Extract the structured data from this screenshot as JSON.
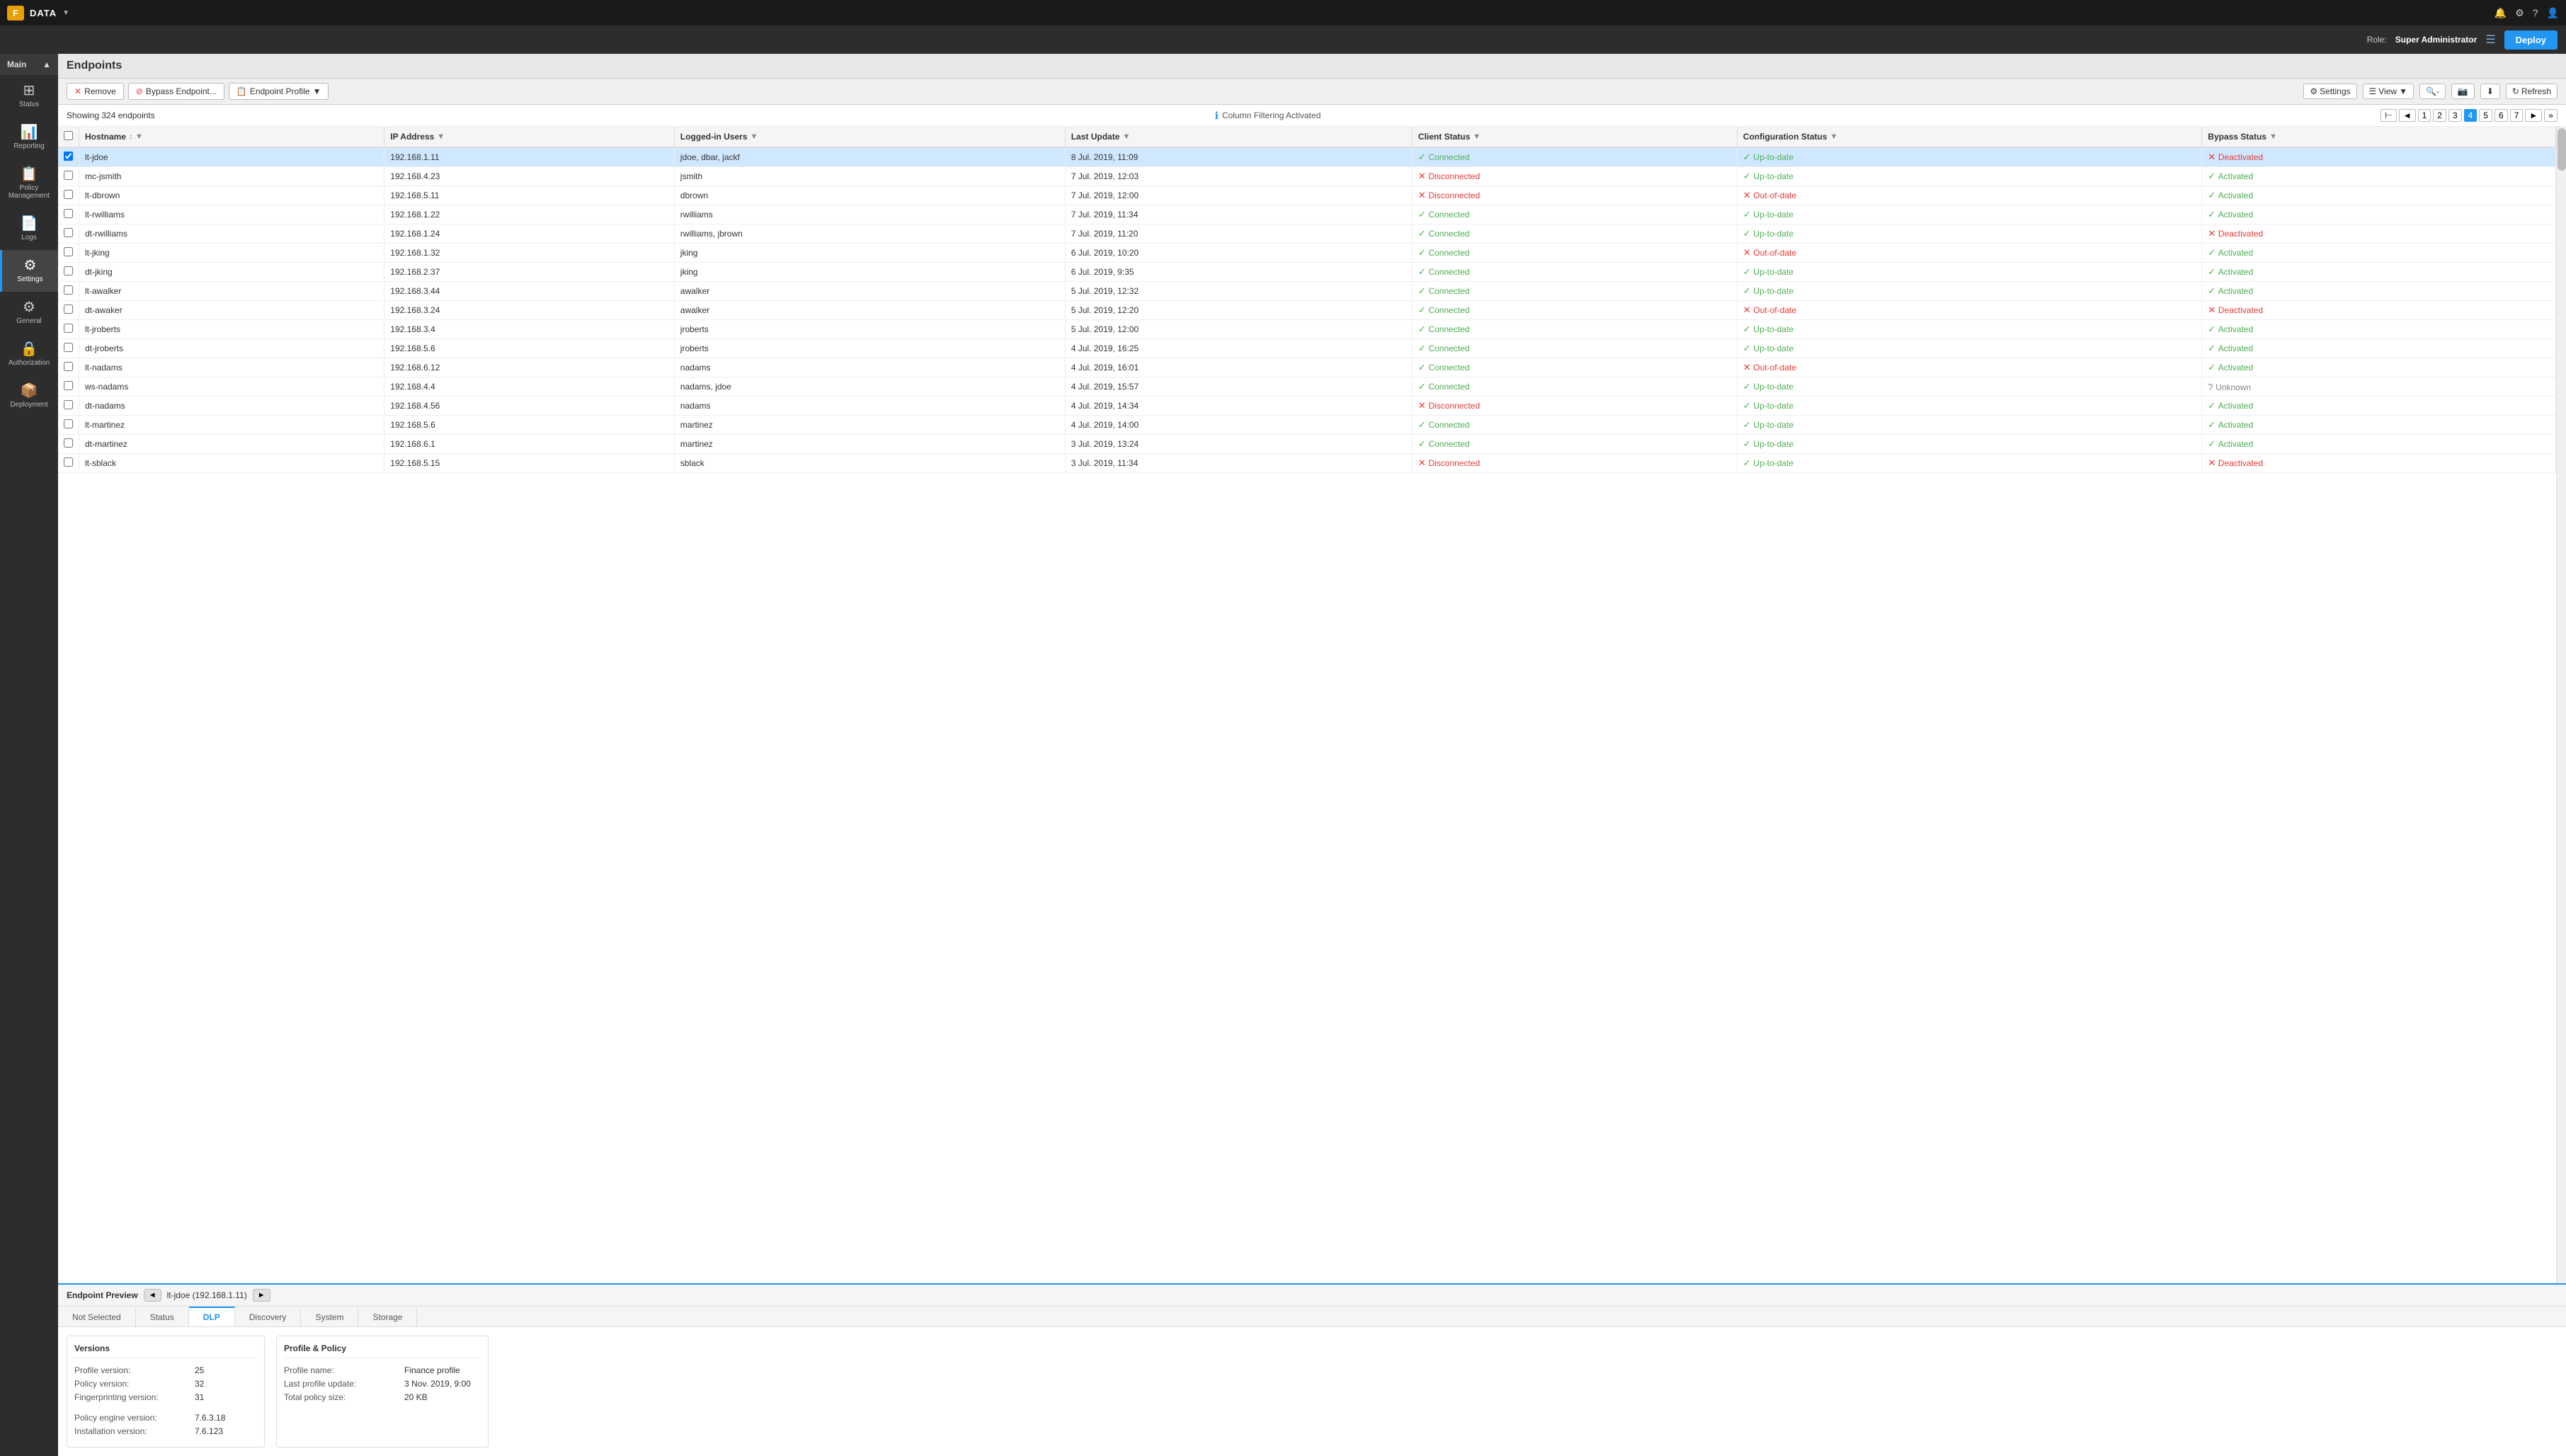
{
  "app": {
    "logo": "F",
    "title": "DATA",
    "role_label": "Role:",
    "role_name": "Super Administrator",
    "deploy_btn": "Deploy"
  },
  "sidebar": {
    "main_label": "Main",
    "items": [
      {
        "id": "status",
        "label": "Status",
        "icon": "⊞",
        "active": false
      },
      {
        "id": "reporting",
        "label": "Reporting",
        "icon": "📊",
        "active": false
      },
      {
        "id": "policy-management",
        "label": "Policy Management",
        "icon": "📋",
        "active": false
      },
      {
        "id": "logs",
        "label": "Logs",
        "icon": "📄",
        "active": false
      },
      {
        "id": "settings",
        "label": "Settings",
        "icon": "⚙",
        "active": true
      },
      {
        "id": "general",
        "label": "General",
        "icon": "⚙",
        "active": false
      },
      {
        "id": "authorization",
        "label": "Authorization",
        "icon": "🔒",
        "active": false
      },
      {
        "id": "deployment",
        "label": "Deployment",
        "icon": "📦",
        "active": false
      }
    ]
  },
  "page": {
    "title": "Endpoints",
    "endpoint_count": "Showing 324 endpoints",
    "filter_notice": "Column Filtering Activated"
  },
  "toolbar": {
    "remove_btn": "Remove",
    "bypass_btn": "Bypass Endpoint...",
    "profile_btn": "Endpoint Profile",
    "settings_btn": "Settings",
    "view_btn": "View",
    "refresh_btn": "Refresh"
  },
  "pagination": {
    "pages": [
      "1",
      "2",
      "3",
      "4",
      "5",
      "6",
      "7"
    ],
    "active_page": "4",
    "prev": "◄",
    "next": "►",
    "last": "»"
  },
  "table": {
    "columns": [
      "Hostname",
      "IP Address",
      "Logged-in Users",
      "Last Update",
      "Client Status",
      "Configuration Status",
      "Bypass Status"
    ],
    "rows": [
      {
        "hostname": "lt-jdoe",
        "ip": "192.168.1.11",
        "users": "jdoe, dbar, jackf",
        "last_update": "8 Jul. 2019, 11:09",
        "client_status": "Connected",
        "client_ok": true,
        "config_status": "Up-to-date",
        "config_ok": true,
        "bypass_status": "Deactivated",
        "bypass_ok": false,
        "selected": true
      },
      {
        "hostname": "mc-jsmith",
        "ip": "192.168.4.23",
        "users": "jsmith",
        "last_update": "7 Jul. 2019, 12:03",
        "client_status": "Disconnected",
        "client_ok": false,
        "config_status": "Up-to-date",
        "config_ok": true,
        "bypass_status": "Activated",
        "bypass_ok": true,
        "selected": false
      },
      {
        "hostname": "lt-dbrown",
        "ip": "192.168.5.11",
        "users": "dbrown",
        "last_update": "7 Jul. 2019, 12:00",
        "client_status": "Disconnected",
        "client_ok": false,
        "config_status": "Out-of-date",
        "config_ok": false,
        "bypass_status": "Activated",
        "bypass_ok": true,
        "selected": false
      },
      {
        "hostname": "lt-rwilliams",
        "ip": "192.168.1.22",
        "users": "rwilliams",
        "last_update": "7 Jul. 2019, 11:34",
        "client_status": "Connected",
        "client_ok": true,
        "config_status": "Up-to-date",
        "config_ok": true,
        "bypass_status": "Activated",
        "bypass_ok": true,
        "selected": false
      },
      {
        "hostname": "dt-rwilliams",
        "ip": "192.168.1.24",
        "users": "rwilliams, jbrown",
        "last_update": "7 Jul. 2019, 11:20",
        "client_status": "Connected",
        "client_ok": true,
        "config_status": "Up-to-date",
        "config_ok": true,
        "bypass_status": "Deactivated",
        "bypass_ok": false,
        "selected": false
      },
      {
        "hostname": "lt-jking",
        "ip": "192.168.1.32",
        "users": "jking",
        "last_update": "6 Jul. 2019, 10:20",
        "client_status": "Connected",
        "client_ok": true,
        "config_status": "Out-of-date",
        "config_ok": false,
        "bypass_status": "Activated",
        "bypass_ok": true,
        "selected": false
      },
      {
        "hostname": "dt-jking",
        "ip": "192.168.2.37",
        "users": "jking",
        "last_update": "6 Jul. 2019, 9:35",
        "client_status": "Connected",
        "client_ok": true,
        "config_status": "Up-to-date",
        "config_ok": true,
        "bypass_status": "Activated",
        "bypass_ok": true,
        "selected": false
      },
      {
        "hostname": "lt-awalker",
        "ip": "192.168.3.44",
        "users": "awalker",
        "last_update": "5 Jul. 2019, 12:32",
        "client_status": "Connected",
        "client_ok": true,
        "config_status": "Up-to-date",
        "config_ok": true,
        "bypass_status": "Activated",
        "bypass_ok": true,
        "selected": false
      },
      {
        "hostname": "dt-awaker",
        "ip": "192.168.3.24",
        "users": "awalker",
        "last_update": "5 Jul. 2019, 12:20",
        "client_status": "Connected",
        "client_ok": true,
        "config_status": "Out-of-date",
        "config_ok": false,
        "bypass_status": "Deactivated",
        "bypass_ok": false,
        "selected": false
      },
      {
        "hostname": "lt-jroberts",
        "ip": "192.168.3.4",
        "users": "jroberts",
        "last_update": "5 Jul. 2019, 12:00",
        "client_status": "Connected",
        "client_ok": true,
        "config_status": "Up-to-date",
        "config_ok": true,
        "bypass_status": "Activated",
        "bypass_ok": true,
        "selected": false
      },
      {
        "hostname": "dt-jroberts",
        "ip": "192.168.5.6",
        "users": "jroberts",
        "last_update": "4 Jul. 2019, 16:25",
        "client_status": "Connected",
        "client_ok": true,
        "config_status": "Up-to-date",
        "config_ok": true,
        "bypass_status": "Activated",
        "bypass_ok": true,
        "selected": false
      },
      {
        "hostname": "lt-nadams",
        "ip": "192.168.6.12",
        "users": "nadams",
        "last_update": "4 Jul. 2019, 16:01",
        "client_status": "Connected",
        "client_ok": true,
        "config_status": "Out-of-date",
        "config_ok": false,
        "bypass_status": "Activated",
        "bypass_ok": true,
        "selected": false
      },
      {
        "hostname": "ws-nadams",
        "ip": "192.168.4.4",
        "users": "nadams, jdoe",
        "last_update": "4 Jul. 2019, 15:57",
        "client_status": "Connected",
        "client_ok": true,
        "config_status": "Up-to-date",
        "config_ok": true,
        "bypass_status": "Unknown",
        "bypass_ok": null,
        "selected": false
      },
      {
        "hostname": "dt-nadams",
        "ip": "192.168.4.56",
        "users": "nadams",
        "last_update": "4 Jul. 2019, 14:34",
        "client_status": "Disconnected",
        "client_ok": false,
        "config_status": "Up-to-date",
        "config_ok": true,
        "bypass_status": "Activated",
        "bypass_ok": true,
        "selected": false
      },
      {
        "hostname": "lt-martinez",
        "ip": "192.168.5.6",
        "users": "martinez",
        "last_update": "4 Jul. 2019, 14:00",
        "client_status": "Connected",
        "client_ok": true,
        "config_status": "Up-to-date",
        "config_ok": true,
        "bypass_status": "Activated",
        "bypass_ok": true,
        "selected": false
      },
      {
        "hostname": "dt-martinez",
        "ip": "192.168.6.1",
        "users": "martinez",
        "last_update": "3 Jul. 2019, 13:24",
        "client_status": "Connected",
        "client_ok": true,
        "config_status": "Up-to-date",
        "config_ok": true,
        "bypass_status": "Activated",
        "bypass_ok": true,
        "selected": false
      },
      {
        "hostname": "lt-sblack",
        "ip": "192.168.5.15",
        "users": "sblack",
        "last_update": "3 Jul. 2019, 11:34",
        "client_status": "Disconnected",
        "client_ok": false,
        "config_status": "Up-to-date",
        "config_ok": true,
        "bypass_status": "Deactivated",
        "bypass_ok": false,
        "selected": false
      }
    ]
  },
  "endpoint_preview": {
    "title": "Endpoint Preview",
    "endpoint_name": "lt-jdoe (192.168.1.11)",
    "tabs": [
      {
        "id": "not-selected",
        "label": "Not Selected"
      },
      {
        "id": "status",
        "label": "Status"
      },
      {
        "id": "dlp",
        "label": "DLP",
        "active": true
      },
      {
        "id": "discovery",
        "label": "Discovery"
      },
      {
        "id": "system",
        "label": "System"
      },
      {
        "id": "storage",
        "label": "Storage"
      }
    ],
    "dlp": {
      "versions_title": "Versions",
      "profile_policy_title": "Profile & Policy",
      "profile_version_label": "Profile version:",
      "profile_version": "25",
      "policy_version_label": "Policy version:",
      "policy_version": "32",
      "fingerprinting_label": "Fingerprinting version:",
      "fingerprinting_version": "31",
      "policy_engine_label": "Policy engine version:",
      "policy_engine_version": "7.6.3.18",
      "installation_label": "Installation version:",
      "installation_version": "7.6.123",
      "profile_name_label": "Profile name:",
      "profile_name": "Finance profile",
      "last_profile_label": "Last profile update:",
      "last_profile_value": "3 Nov. 2019, 9:00",
      "total_policy_label": "Total policy size:",
      "total_policy_value": "20 KB"
    }
  }
}
